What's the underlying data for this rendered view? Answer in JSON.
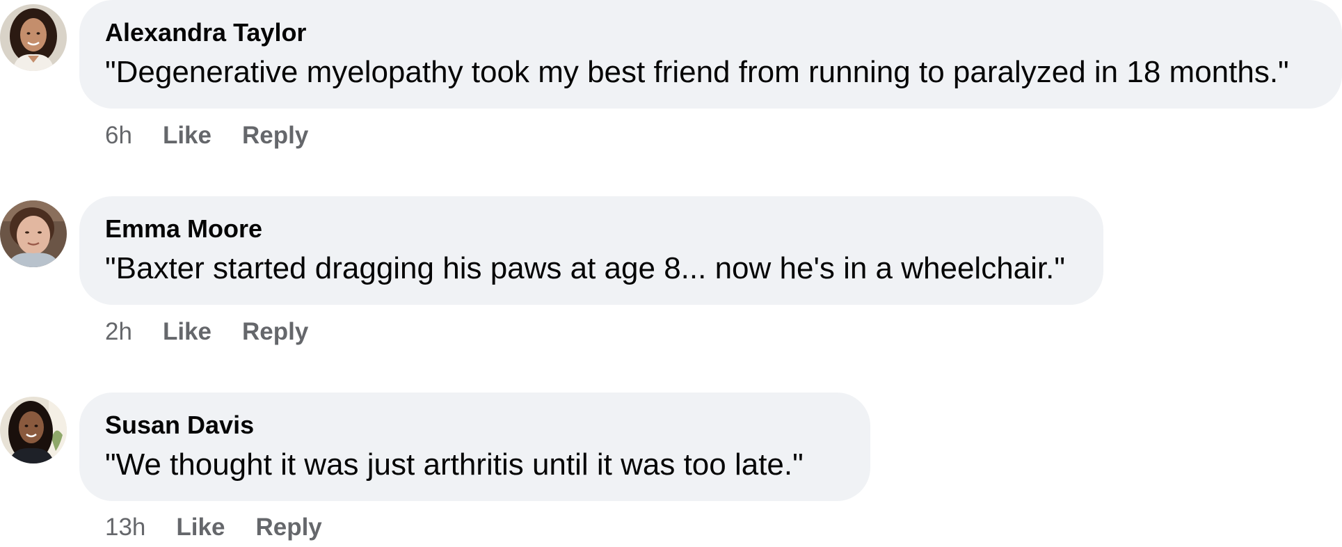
{
  "comments": [
    {
      "author": "Alexandra Taylor",
      "text": "\"Degenerative myelopathy took my best friend from running to paralyzed in 18 months.\"",
      "time": "6h",
      "like_label": "Like",
      "reply_label": "Reply"
    },
    {
      "author": "Emma Moore",
      "text": "\"Baxter started dragging his paws at age 8... now he's in a wheelchair.\"",
      "time": "2h",
      "like_label": "Like",
      "reply_label": "Reply"
    },
    {
      "author": "Susan Davis",
      "text": "\"We thought it was just arthritis until it was too late.\"",
      "time": "13h",
      "like_label": "Like",
      "reply_label": "Reply"
    }
  ],
  "colors": {
    "bubble_background": "#f0f2f5",
    "author_text": "#050505",
    "meta_text": "#65676b"
  }
}
